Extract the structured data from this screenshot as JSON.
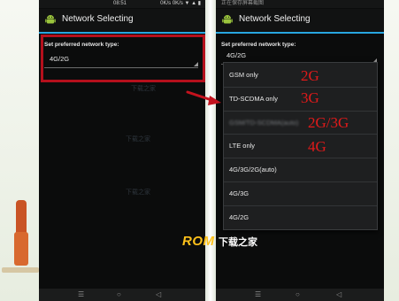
{
  "screens": [
    {
      "status": {
        "time": "08:51",
        "left": "",
        "icons": "0K/s 0K/s ▼ ▲ ▮"
      },
      "title": "Network Selecting",
      "section_label": "Set preferred network type:",
      "spinner_value": "4G/2G",
      "watermark": [
        "下载之家",
        "下载之家",
        "下载之家"
      ]
    },
    {
      "status": {
        "time": "",
        "left": "正在保存屏幕截图",
        "icons": ""
      },
      "title": "Network Selecting",
      "section_label": "Set preferred network type:",
      "spinner_value": "4G/2G",
      "options": [
        {
          "label": "GSM only",
          "tag": "2G",
          "blurred": false
        },
        {
          "label": "TD-SCDMA only",
          "tag": "3G",
          "blurred": false
        },
        {
          "label": "GSM/TD-SCDMA(auto)",
          "tag": "2G/3G",
          "blurred": true
        },
        {
          "label": "LTE only",
          "tag": "4G",
          "blurred": false
        },
        {
          "label": "4G/3G/2G(auto)",
          "tag": "",
          "blurred": false
        },
        {
          "label": "4G/3G",
          "tag": "",
          "blurred": false
        },
        {
          "label": "4G/2G",
          "tag": "",
          "blurred": false
        }
      ]
    }
  ],
  "nav_icons": [
    "menu-icon",
    "home-icon",
    "back-icon"
  ],
  "logo": {
    "latin": "ROM",
    "cn": "下载之家"
  },
  "colors": {
    "highlight": "#b5101c",
    "accent_blue": "#28a6e0",
    "tag_red": "#e11a1a",
    "logo_yellow": "#ffc21a"
  }
}
